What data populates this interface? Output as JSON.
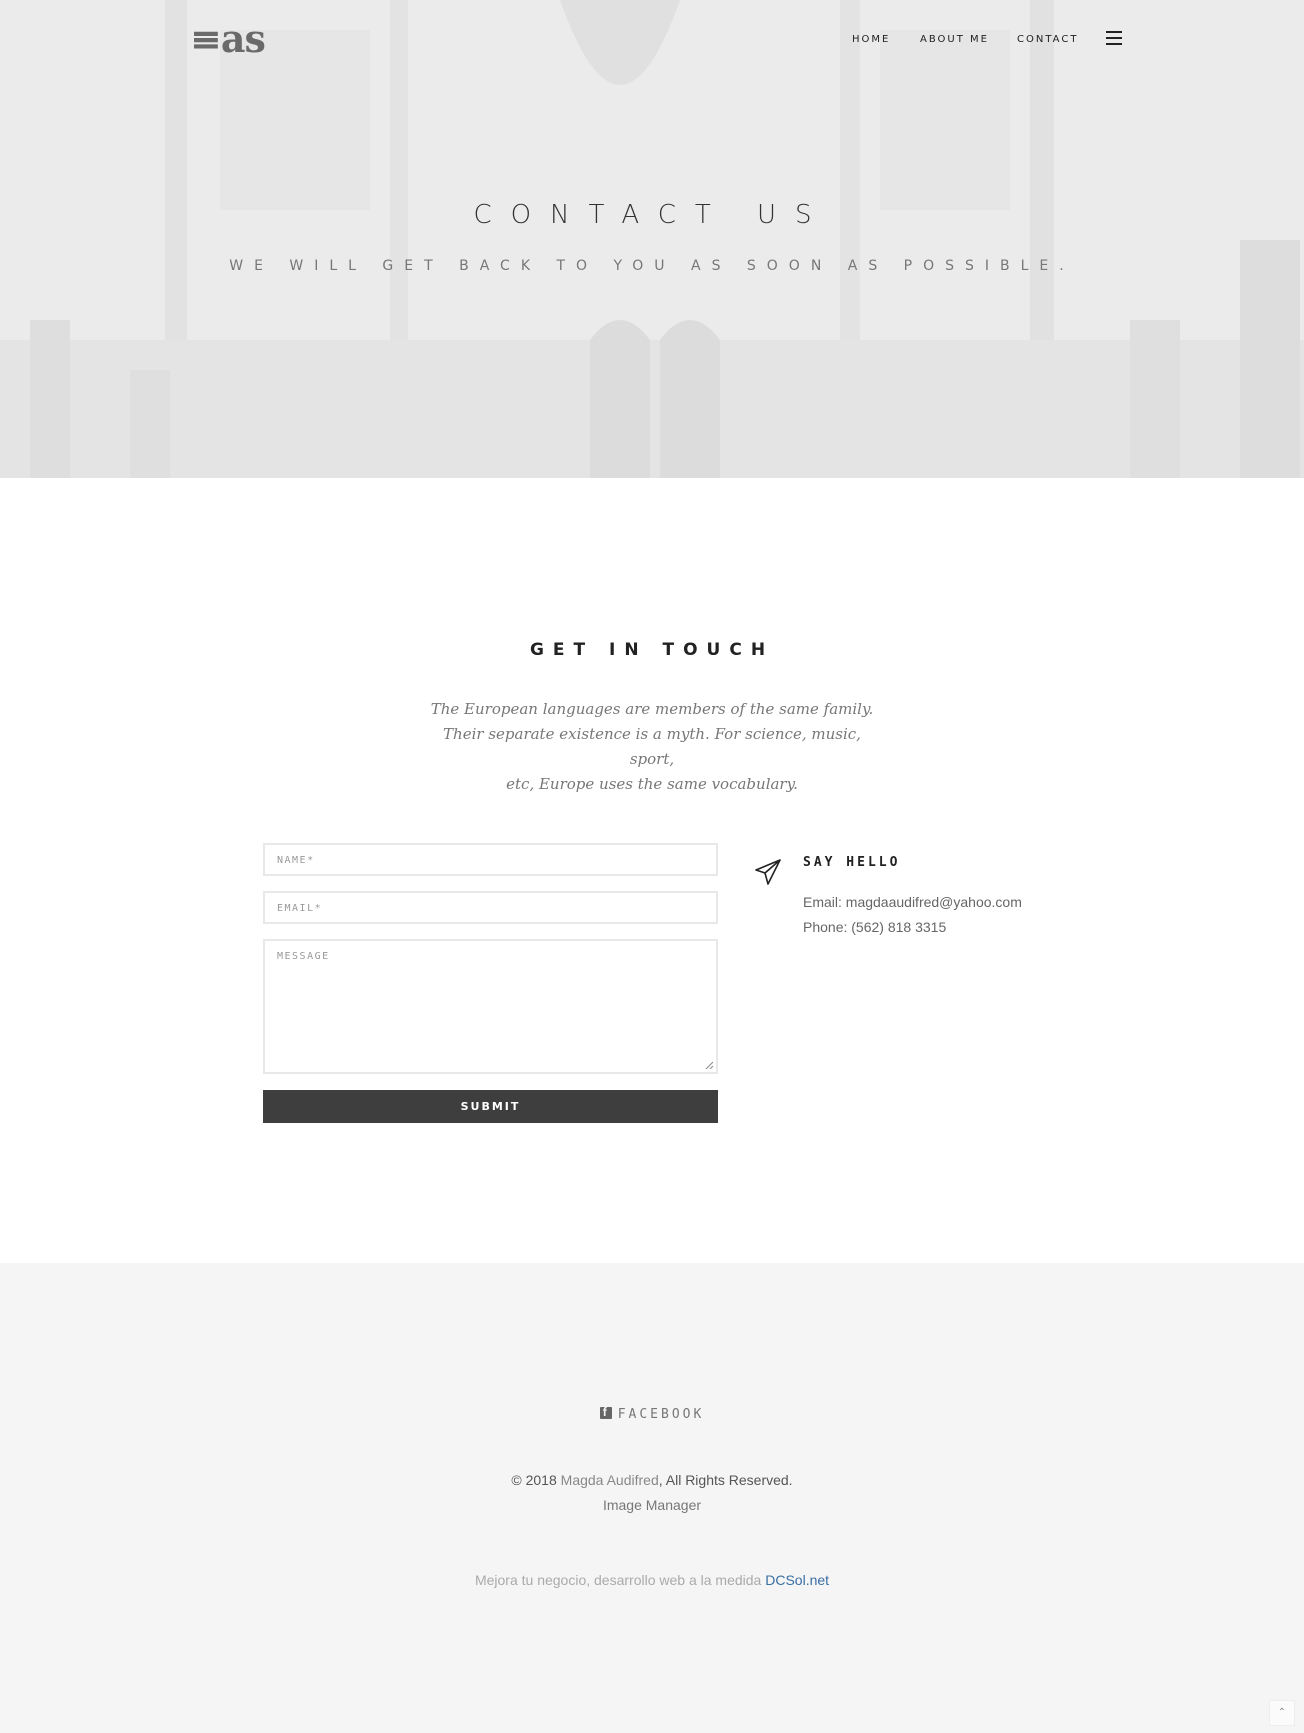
{
  "header": {
    "logo": "≡as",
    "nav": [
      {
        "label": "HOME"
      },
      {
        "label": "ABOUT ME"
      },
      {
        "label": "CONTACT"
      }
    ],
    "menu_icon": "hamburger-icon"
  },
  "hero": {
    "title": "CONTACT US",
    "subtitle": "WE WILL GET BACK TO YOU AS SOON AS POSSIBLE."
  },
  "contact": {
    "title": "GET IN TOUCH",
    "intro": [
      "The European languages are members of the same family.",
      "Their separate existence is a myth. For science, music, sport,",
      "etc, Europe uses the same vocabulary."
    ],
    "form": {
      "name_placeholder": "NAME*",
      "email_placeholder": "EMAIL*",
      "message_placeholder": "MESSAGE",
      "submit_label": "SUBMIT"
    },
    "say_hello": {
      "icon": "paper-plane-icon",
      "title": "SAY HELLO",
      "email_line": "Email: magdaaudifred@yahoo.com",
      "phone_line": "Phone: (562) 818 3315"
    }
  },
  "footer": {
    "facebook_label": "FACEBOOK",
    "copyright_prefix": "© 2018 ",
    "copyright_owner": "Magda Audifred",
    "copyright_suffix": ", All Rights Reserved.",
    "image_manager": "Image Manager",
    "promo_text": "Mejora tu negocio, desarrollo web a la medida ",
    "promo_link": "DCSol.net",
    "to_top_icon": "double-chevron-up-icon"
  },
  "colors": {
    "submit_bg": "#3e3e3e",
    "footer_bg": "#f5f5f5",
    "link_blue": "#3a6ea5"
  }
}
